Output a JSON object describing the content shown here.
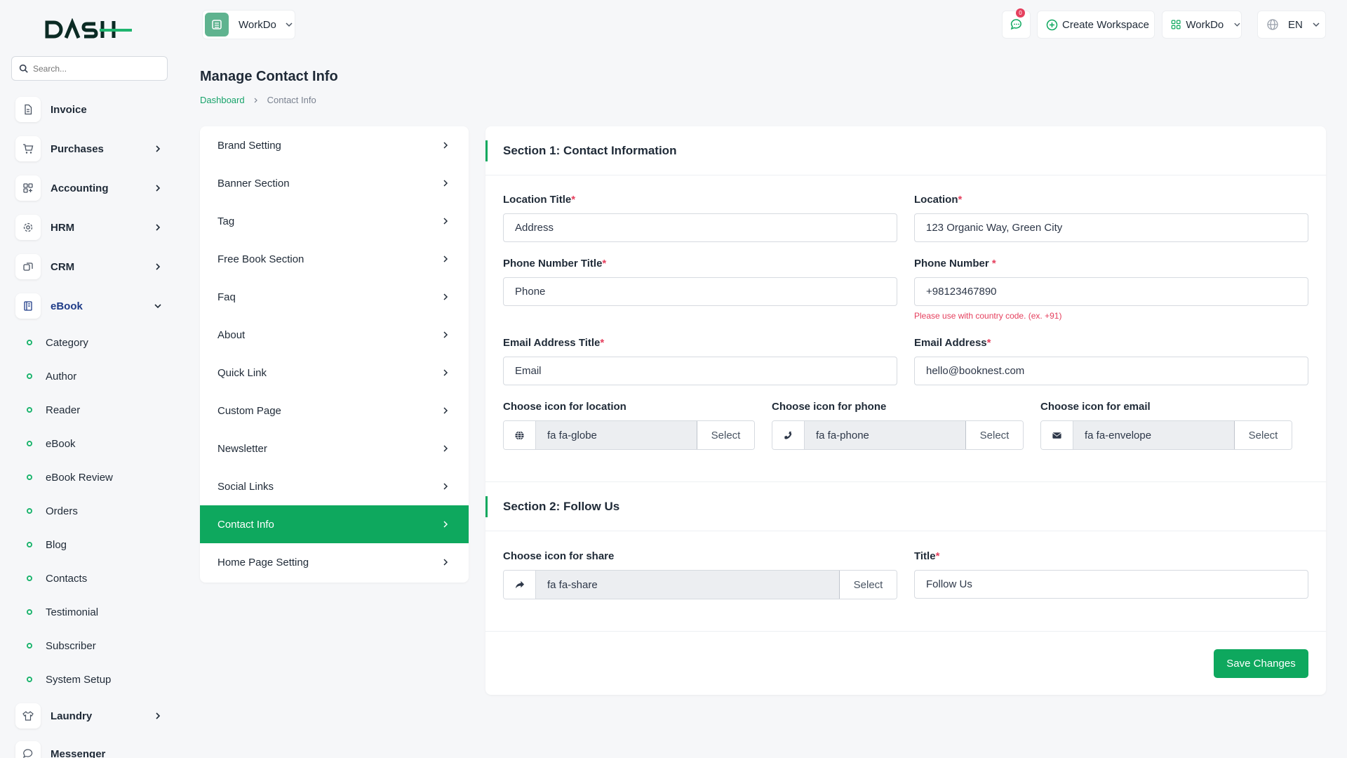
{
  "brand": {
    "logo_text": "DASH"
  },
  "search": {
    "placeholder": "Search..."
  },
  "sidebar": {
    "items": [
      {
        "label": "Invoice",
        "icon": "file-icon"
      },
      {
        "label": "Purchases",
        "icon": "cart-icon"
      },
      {
        "label": "Accounting",
        "icon": "grid-icon"
      },
      {
        "label": "HRM",
        "icon": "settings-icon"
      },
      {
        "label": "CRM",
        "icon": "layers-icon"
      },
      {
        "label": "eBook",
        "icon": "book-icon"
      }
    ],
    "ebook_sub": [
      "Category",
      "Author",
      "Reader",
      "eBook",
      "eBook Review",
      "Orders",
      "Blog",
      "Contacts",
      "Testimonial",
      "Subscriber",
      "System Setup"
    ],
    "after": [
      {
        "label": "Laundry",
        "icon": "shirt-icon"
      },
      {
        "label": "Messenger",
        "icon": "chat-icon"
      }
    ]
  },
  "header": {
    "workspace": "WorkDo",
    "notifications": "0",
    "create_workspace": "Create Workspace",
    "company": "WorkDo",
    "language": "EN"
  },
  "page": {
    "title": "Manage Contact Info",
    "breadcrumb_home": "Dashboard",
    "breadcrumb_current": "Contact Info"
  },
  "settings_menu": [
    "Brand Setting",
    "Banner Section",
    "Tag",
    "Free Book Section",
    "Faq",
    "About",
    "Quick Link",
    "Custom Page",
    "Newsletter",
    "Social Links",
    "Contact Info",
    "Home Page Setting"
  ],
  "section1": {
    "title": "Section 1: Contact Information",
    "location_title_label": "Location Title",
    "location_title_value": "Address",
    "location_label": "Location",
    "location_value": "123 Organic Way, Green City",
    "phone_title_label": "Phone Number Title",
    "phone_title_value": "Phone",
    "phone_label": "Phone Number ",
    "phone_value": "+98123467890",
    "phone_hint": "Please use with country code. (ex. +91)",
    "email_title_label": "Email Address Title",
    "email_title_value": "Email",
    "email_label": "Email Address",
    "email_value": "hello@booknest.com",
    "icon_location_label": "Choose icon for location",
    "icon_location_value": "fa fa-globe",
    "icon_phone_label": "Choose icon for phone",
    "icon_phone_value": "fa fa-phone",
    "icon_email_label": "Choose icon for email",
    "icon_email_value": "fa fa-envelope",
    "select_label": "Select"
  },
  "section2": {
    "title": "Section 2: Follow Us",
    "icon_share_label": "Choose icon for share",
    "icon_share_value": "fa fa-share",
    "title_label": "Title",
    "title_value": "Follow Us"
  },
  "actions": {
    "save": "Save Changes"
  },
  "colors": {
    "accent": "#0ea85e",
    "required": "#e5405e"
  }
}
